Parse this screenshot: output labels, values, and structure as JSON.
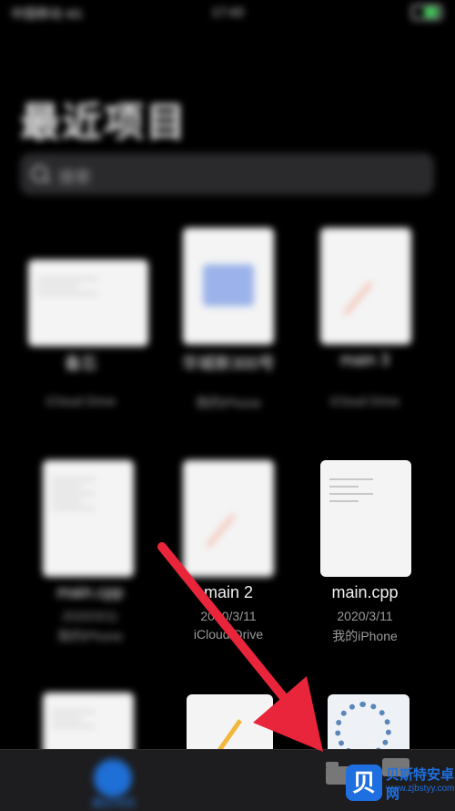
{
  "status_bar": {
    "carrier": "中国移动 4G",
    "time": "17:43",
    "battery_icon": "battery-icon"
  },
  "header": {
    "title": "最近项目"
  },
  "search": {
    "placeholder": "搜索"
  },
  "files": [
    {
      "name": "备忘",
      "location": "iCloud Drive"
    },
    {
      "name": "华城新300号",
      "location": "我的iPhone"
    },
    {
      "name": "main 3",
      "location": "iCloud Drive"
    },
    {
      "name": "main.cpp",
      "date": "2020/3/11",
      "location": "我的iPhone"
    },
    {
      "name": "main 2",
      "date": "2020/3/11",
      "location": "iCloud Drive"
    },
    {
      "name": "main.cpp",
      "date": "2020/3/11",
      "location": "我的iPhone"
    }
  ],
  "tabbar": {
    "recent_label": "最近项目",
    "browse_label": "浏览"
  },
  "annotation": {
    "arrow_color": "#e8253a"
  },
  "watermark": {
    "badge": "贝",
    "name": "贝斯特安卓网",
    "url": "www.zjbstyy.com"
  },
  "colors": {
    "accent": "#1e6fd6",
    "background": "#000000",
    "battery": "#3fd15c"
  }
}
